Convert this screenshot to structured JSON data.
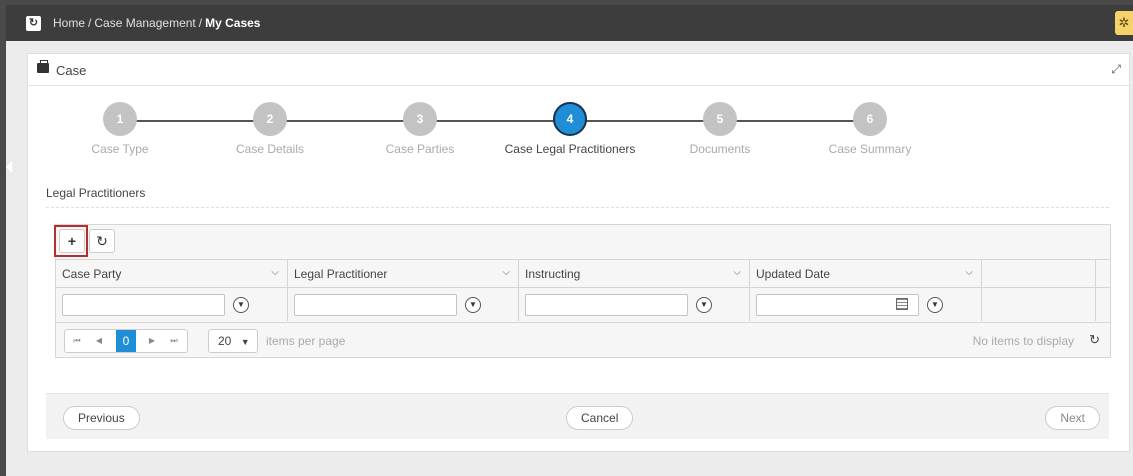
{
  "breadcrumb": {
    "home": "Home",
    "section": "Case Management",
    "current": "My Cases",
    "separator": "/"
  },
  "panel": {
    "title": "Case"
  },
  "steps": [
    {
      "number": "1",
      "label": "Case Type",
      "active": false
    },
    {
      "number": "2",
      "label": "Case Details",
      "active": false
    },
    {
      "number": "3",
      "label": "Case Parties",
      "active": false
    },
    {
      "number": "4",
      "label": "Case Legal Practitioners",
      "active": true
    },
    {
      "number": "5",
      "label": "Documents",
      "active": false
    },
    {
      "number": "6",
      "label": "Case Summary",
      "active": false
    }
  ],
  "section_title": "Legal Practitioners",
  "toolbar": {
    "add_label": "+",
    "refresh_label": "↻"
  },
  "columns": [
    {
      "header": "Case Party"
    },
    {
      "header": "Legal Practitioner"
    },
    {
      "header": "Instructing"
    },
    {
      "header": "Updated Date"
    }
  ],
  "pager": {
    "first": "⏮",
    "prev": "◀",
    "page": "0",
    "next": "▶",
    "last": "⏭",
    "page_size": "20",
    "page_size_suffix": "items per page",
    "info": "No items to display"
  },
  "footer": {
    "previous": "Previous",
    "cancel": "Cancel",
    "next": "Next"
  },
  "colors": {
    "accent": "#1f8ed6",
    "topbar": "#3d3d3d",
    "highlight": "#b32e2e"
  }
}
